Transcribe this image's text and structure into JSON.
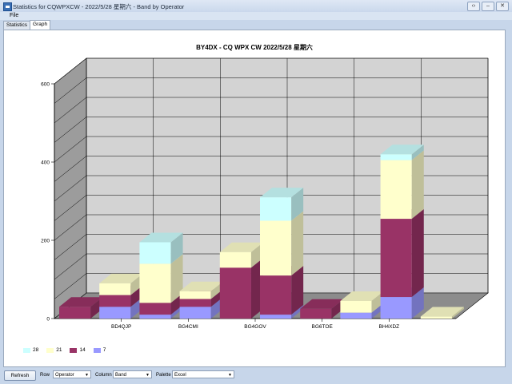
{
  "window": {
    "title": "Statistics for CQWPXCW - 2022/5/28 星期六 - Band by Operator",
    "buttons": [
      "‹›",
      "–",
      "✕"
    ]
  },
  "menu": {
    "file": "File"
  },
  "tabs": [
    {
      "label": "Statistics"
    },
    {
      "label": "Graph"
    }
  ],
  "chart_data": {
    "type": "bar",
    "title": "BY4DX - CQ WPX  CW 2022/5/28 星期六",
    "categories": [
      "BD4QJP",
      "BG4CMI",
      "BG4GOV",
      "BG6TOE",
      "BH4XDZ"
    ],
    "series": [
      {
        "name": "7",
        "color": "#9999ff",
        "values": [
          0,
          30,
          10,
          30,
          0,
          10,
          0,
          15,
          55,
          0
        ]
      },
      {
        "name": "14",
        "color": "#993366",
        "values": [
          30,
          30,
          30,
          20,
          130,
          100,
          25,
          0,
          200,
          0
        ]
      },
      {
        "name": "21",
        "color": "#ffffcc",
        "values": [
          0,
          30,
          100,
          20,
          40,
          140,
          0,
          30,
          150,
          5
        ]
      },
      {
        "name": "28",
        "color": "#ccffff",
        "values": [
          0,
          0,
          55,
          0,
          0,
          60,
          0,
          0,
          15,
          0
        ]
      }
    ],
    "ylim": [
      0,
      600
    ],
    "yticks": [
      "0",
      "200",
      "400",
      "600"
    ],
    "grid": true,
    "legend": "bottom-left"
  },
  "toolbar": {
    "refresh": "Refresh",
    "row_label": "Row",
    "row_value": "Operator",
    "column_label": "Column",
    "column_value": "Band",
    "palette_label": "Palette",
    "palette_value": "Excel",
    "arrow": "▼"
  }
}
